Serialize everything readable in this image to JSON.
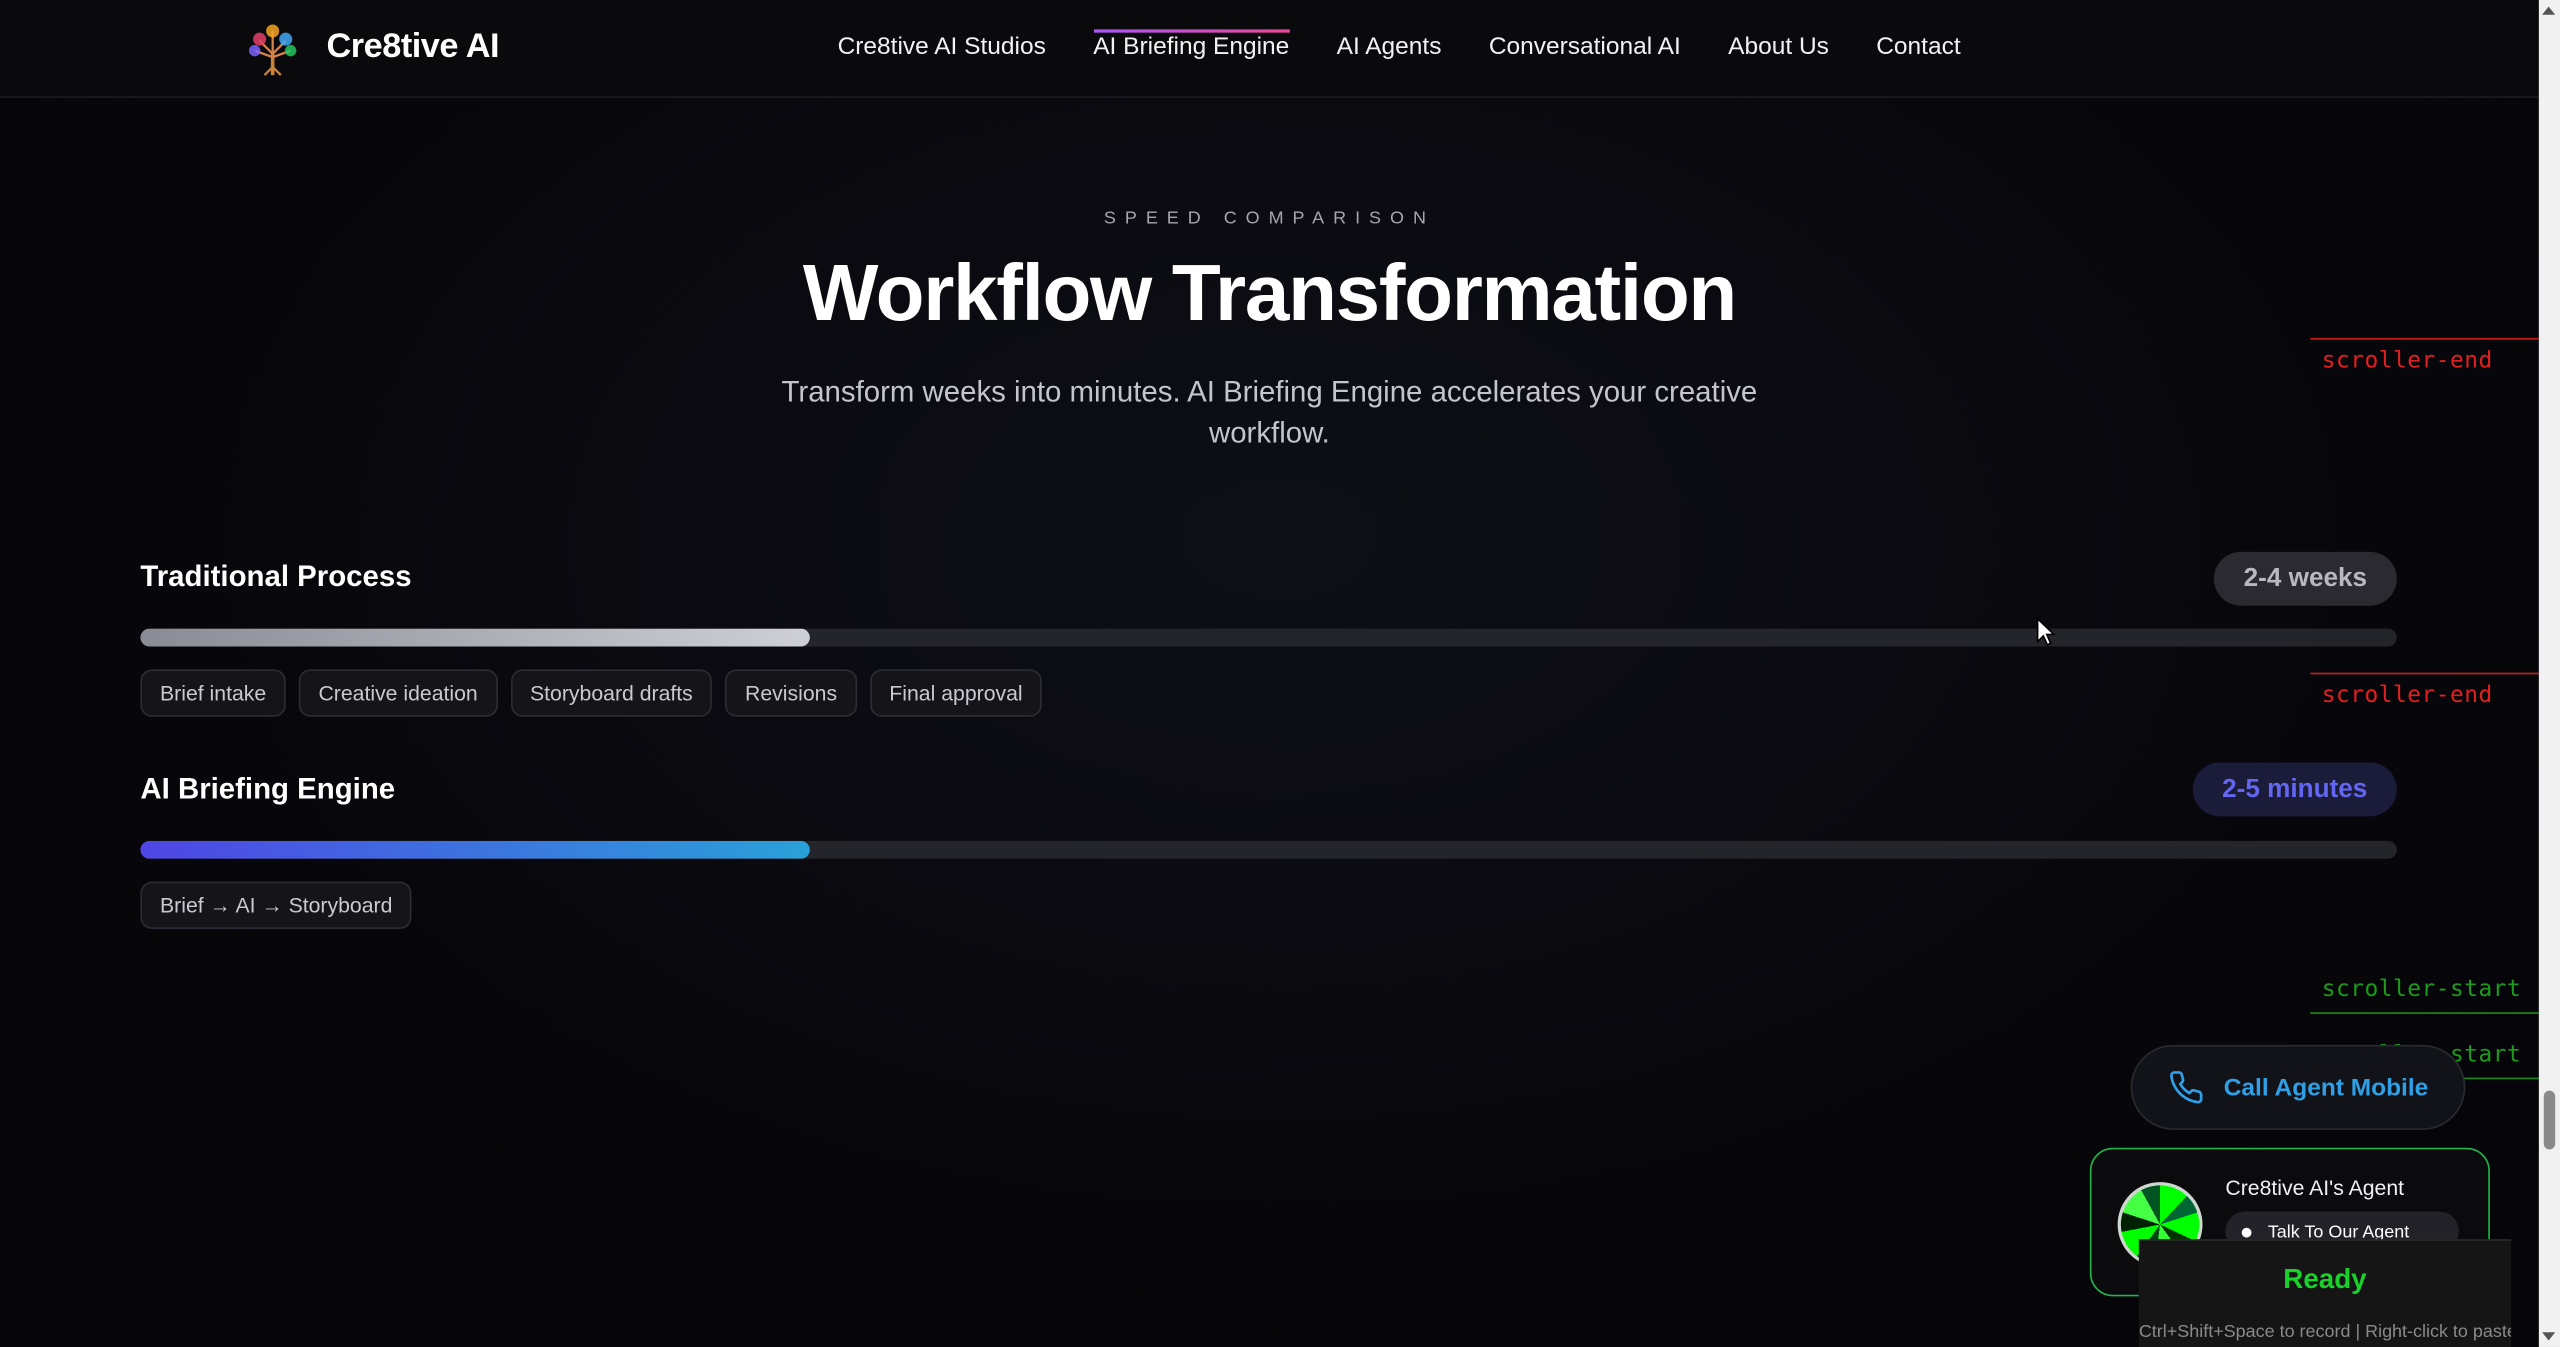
{
  "header": {
    "brand": "Cre8tive AI",
    "logo_icon": "tree-logo-icon",
    "nav": [
      {
        "label": "Cre8tive AI Studios",
        "active": false
      },
      {
        "label": "AI Briefing Engine",
        "active": true
      },
      {
        "label": "AI Agents",
        "active": false
      },
      {
        "label": "Conversational AI",
        "active": false
      },
      {
        "label": "About Us",
        "active": false
      },
      {
        "label": "Contact",
        "active": false
      }
    ]
  },
  "section": {
    "eyebrow": "SPEED COMPARISON",
    "title": "Workflow Transformation",
    "subtitle": "Transform weeks into minutes. AI Briefing Engine accelerates your creative workflow."
  },
  "comparison": {
    "traditional": {
      "title": "Traditional Process",
      "duration": "2-4 weeks",
      "progress": 0.297,
      "steps": [
        "Brief intake",
        "Creative ideation",
        "Storyboard drafts",
        "Revisions",
        "Final approval"
      ]
    },
    "ai": {
      "title": "AI Briefing Engine",
      "duration": "2-5 minutes",
      "progress": 0.297,
      "steps": [
        "Brief → AI → Storyboard"
      ]
    }
  },
  "debug_markers": {
    "end_label": "scroller-end",
    "start_label": "scroller-start"
  },
  "widgets": {
    "call_button_label": "Call Agent Mobile",
    "agent_name": "Cre8tive AI's Agent",
    "talk_button_label": "Talk To Our Agent",
    "ready_status": "Ready",
    "ready_hint": "Ctrl+Shift+Space to record | Right-click to paste"
  },
  "colors": {
    "accent_blue": "#4f46e5",
    "accent_cyan": "#2aa1d8",
    "ready_green": "#19d12b",
    "marker_red": "#e02020",
    "marker_green": "#1b9a1b"
  }
}
